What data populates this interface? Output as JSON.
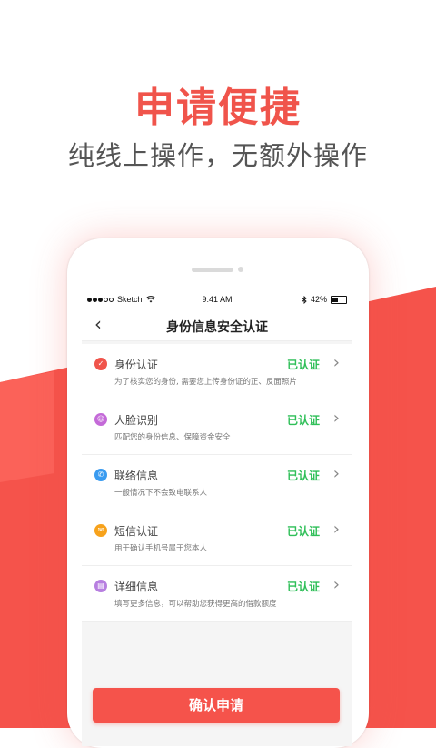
{
  "hero": {
    "title": "申请便捷",
    "subtitle": "纯线上操作，无额外操作"
  },
  "status_bar": {
    "carrier": "Sketch",
    "time": "9:41 AM",
    "battery": "42%"
  },
  "nav": {
    "back_icon": "chevron-left-icon",
    "title": "身份信息安全认证"
  },
  "items": [
    {
      "icon": "shield-icon",
      "icon_color": "#f0544b",
      "title": "身份认证",
      "status": "已认证",
      "desc": "为了核实您的身份, 需要您上传身份证的正、反面照片"
    },
    {
      "icon": "face-icon",
      "icon_color": "#c46ad8",
      "title": "人脸识别",
      "status": "已认证",
      "desc": "匹配您的身份信息、保障资金安全"
    },
    {
      "icon": "phone-icon",
      "icon_color": "#3a9bf0",
      "title": "联络信息",
      "status": "已认证",
      "desc": "一般情况下不会致电联系人"
    },
    {
      "icon": "mail-icon",
      "icon_color": "#f7a21b",
      "title": "短信认证",
      "status": "已认证",
      "desc": "用于确认手机号属于您本人"
    },
    {
      "icon": "document-icon",
      "icon_color": "#b77fe0",
      "title": "详细信息",
      "status": "已认证",
      "desc": "填写更多信息，可以帮助您获得更高的借款额度"
    }
  ],
  "confirm_button": "确认申请",
  "colors": {
    "brand_red": "#f5534b",
    "verified_green": "#2fbf58"
  }
}
